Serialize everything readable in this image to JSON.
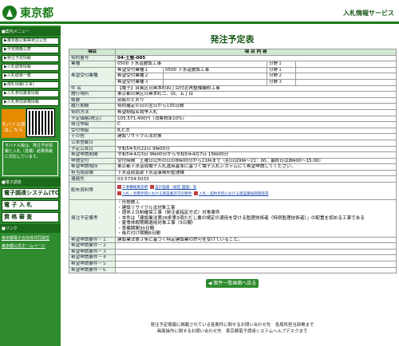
{
  "header": {
    "logo_text": "東京都",
    "service_title": "入札情報サービス"
  },
  "sidebar": {
    "section1": "■案内メニュー",
    "items": [
      "▶東京都公報等発注公告",
      "▶予定価格公表",
      "▶発注予定情報",
      "▶入札結果情報",
      "▶入札結果一覧",
      "▶落札情報(工事)",
      "▶入札参加業者情報",
      "▶入札参加資格情報"
    ],
    "mobile_label": "モバイル版 はこちら",
    "mobile_note": "モバイル版は、発注予定情報と入札（見積）結果情報に対応しています。",
    "section2": "■電子調達",
    "items2": [
      "電子調達システム(TOP)",
      "電 子 入 札",
      "資 格 審 査"
    ],
    "section3": "■リンク",
    "links": [
      "東京都電子自治体共同運営",
      "東京都公式ホームページ"
    ]
  },
  "page": {
    "title": "発注予定表"
  },
  "table": {
    "col_item": "項目",
    "col_content": "項 目 内 容",
    "rows": [
      [
        "契約番号",
        "04-土整-005"
      ],
      [
        "業種",
        "0500 下水道施設工事"
      ],
      [
        "業種2",
        "1 ",
        "0500 下水道施設工事",
        "分野1",
        ""
      ],
      [
        "件 名",
        "【電子】台風区日黒本町四丁目付近再整備補修工事"
      ],
      [
        "施行場所",
        "東京都日黒区日黒本町二、四、五丁目"
      ],
      [
        "概要",
        "別紙のとおり"
      ],
      [
        "履行期間",
        "契約確定の日の翌日から135日間"
      ],
      [
        "契約方法",
        "希望制指名競争入札"
      ],
      [
        "予定価格(税込)",
        "105,571,400円（消費税率10%）"
      ],
      [
        "発注等級",
        "C"
      ],
      [
        "受付等級",
        "B,C,D"
      ],
      [
        "その他",
        "建設リサイクル法対象"
      ],
      [
        "公表登載日",
        ""
      ],
      [
        "予定公表日",
        "令和5年5月22日 9時00分"
      ],
      [
        "希望申請期間",
        "令和5年4月3日 9時00分から令和5年4月7日 15時00分"
      ],
      [
        "申請受付",
        "受付時間　土曜日以外の日の8時00分から21時まで（初日は9時〜21：00、最終日は8時00〜15:00）"
      ],
      [
        "希望申請場所",
        "東京都下水道局電子入札運用基準に基づく電子入札システムにて希望申請してください。"
      ],
      [
        "担当局部課",
        "下水道局南部下水道事務所監理課"
      ],
      [
        "連絡先",
        "03-5734-5033"
      ]
    ],
    "subrows": [
      [
        "希望受付業種１",
        "0500 下水道施設工事",
        "分野１",
        ""
      ],
      [
        "希望受付業種２",
        "",
        "分野２",
        ""
      ],
      [
        "希望受付業種３",
        "",
        "分野３",
        ""
      ]
    ],
    "doc_label": "配布資料等",
    "docs": [
      "工事費概算説明",
      "設計図書（規定 図面）等",
      "入札・見積手続における建設業許可の要件",
      "入札・契約手続における建設業振興施策等"
    ],
    "remarks_label": "発注予定備考",
    "remarks": [
      "・形態施工",
      "・建設リサイクル法対象工事",
      "・週休２日制確保工事（発注者指定方式）対象案件",
      "・本件は「建設業法第26条第3項ただし書の規定の適用を受ける監理技術者（特例監理技術者）」の配置を認める工事である",
      "・夏季休暇期間適用対象工事（5日間）",
      "・準備期間30日間",
      "・後片付け期間8日間"
    ],
    "req_rows": [
      "希望申請要件－１",
      "希望申請要件－２",
      "希望申請要件－３",
      "希望申請要件－４",
      "希望申請要件－５",
      "希望申請要件－６"
    ],
    "req1_value": "建設業法第３条に基づく特定建設業の許可を受けていること。"
  },
  "back_label": "◀ 案件一覧画面へ戻る",
  "footer": [
    "発注予定情報に掲載されている各案件に関するお問い合わせ先　各局所担当部署まで",
    "画面操作に関するお問い合わせ先　東京都電子調達システムヘルプデスクまで"
  ]
}
